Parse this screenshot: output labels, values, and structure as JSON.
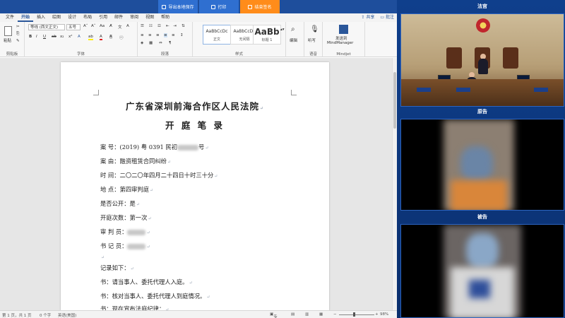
{
  "topbar": {
    "buttons": [
      {
        "label": "导出本地保存",
        "icon": "save-icon"
      },
      {
        "label": "打印",
        "icon": "print-icon"
      },
      {
        "label": "结束签名",
        "icon": "sign-icon"
      }
    ]
  },
  "word": {
    "tabs": [
      "文件",
      "开始",
      "插入",
      "绘图",
      "设计",
      "布局",
      "引用",
      "邮件",
      "审阅",
      "视图",
      "帮助"
    ],
    "active_tab": "开始",
    "share_label": "共享",
    "comment_label": "批注",
    "ribbon": {
      "clipboard": {
        "paste_label": "粘贴",
        "group_label": "剪贴板"
      },
      "font": {
        "font_name": "等线 (西文正文)",
        "font_size": "五号",
        "group_label": "字体"
      },
      "paragraph": {
        "group_label": "段落"
      },
      "styles": {
        "cards": [
          {
            "preview": "AaBbCcDc",
            "name": "正文"
          },
          {
            "preview": "AaBbCcDc",
            "name": "无间隔"
          },
          {
            "preview": "AaBb",
            "name": "标题 1"
          }
        ],
        "group_label": "样式"
      },
      "editing": {
        "label": "编辑"
      },
      "voice": {
        "label": "听写",
        "group_label": "语音"
      },
      "mindjet": {
        "label_line1": "发送到",
        "label_line2": "MindManager",
        "group_label": "Mindjet"
      }
    },
    "document": {
      "title": "广东省深圳前海合作区人民法院",
      "subtitle": "开 庭 笔 录",
      "fields": [
        {
          "label": "案    号：",
          "value": "(2019) 粤 0391 民初",
          "suffix": "号"
        },
        {
          "label": "案    由：",
          "value": "融资租赁合同纠纷"
        },
        {
          "label": "时    间：",
          "value": "二〇二〇年四月二十四日十时三十分"
        },
        {
          "label": "地    点：",
          "value": "第四审判庭"
        },
        {
          "label": "是否公开：",
          "value": "是"
        },
        {
          "label": "开庭次数：",
          "value": "第一次"
        },
        {
          "label": "审 判 员：",
          "value": ""
        },
        {
          "label": "书 记 员：",
          "value": ""
        }
      ],
      "record_heading": "记录如下：",
      "record_lines": [
        "书：请当事人、委托代理人入庭。",
        "书：核对当事人、委托代理人到庭情况。",
        "书：现在宣布法庭纪律："
      ]
    },
    "status": {
      "page": "第 1 页，共 1 页",
      "words": "0 个字",
      "language": "英语(美国)",
      "focus": "专注",
      "zoom": "98%"
    }
  },
  "video": {
    "panes": [
      {
        "title": "法官"
      },
      {
        "title": "原告"
      },
      {
        "title": "被告"
      }
    ]
  }
}
